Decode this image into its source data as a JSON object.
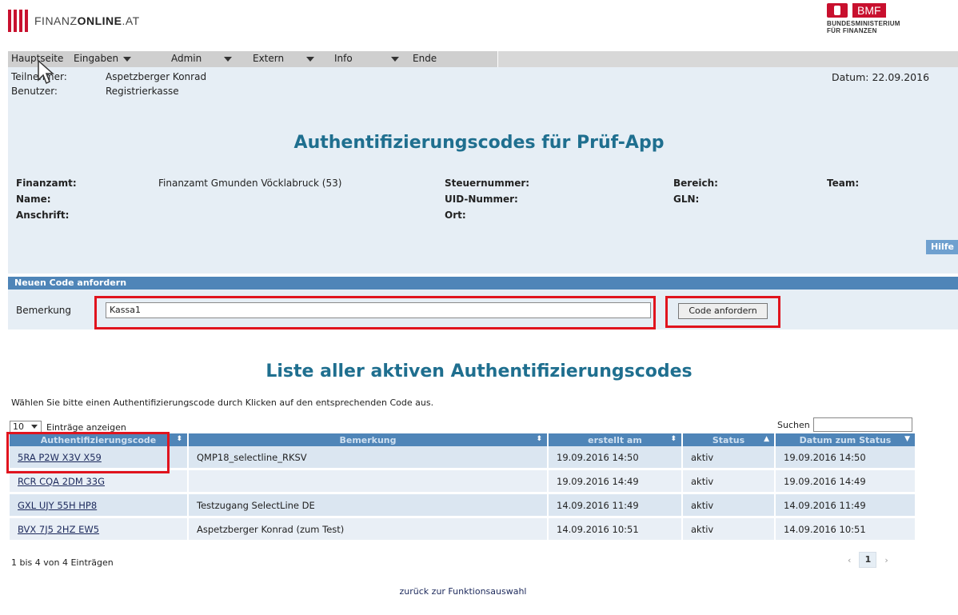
{
  "header": {
    "logo_text_light": "FINANZ",
    "logo_text_bold": "ONLINE",
    "logo_text_suffix": ".AT",
    "bmf_label": "BMF",
    "bmf_sub1": "BUNDESMINISTERIUM",
    "bmf_sub2": "FÜR FINANZEN"
  },
  "menu": {
    "items": [
      {
        "label": "Hauptseite"
      },
      {
        "label": "Eingaben"
      },
      {
        "label": "Admin"
      },
      {
        "label": "Extern"
      },
      {
        "label": "Info"
      },
      {
        "label": "Ende"
      }
    ]
  },
  "session": {
    "participant_label": "Teilnehmer:",
    "participant_value": "Aspetzberger Konrad",
    "user_label": "Benutzer:",
    "user_value": "Registrierkasse",
    "date_label": "Datum: 22.09.2016"
  },
  "page_title": "Authentifizierungscodes für Prüf-App",
  "taxinfo": {
    "finanzamt_label": "Finanzamt:",
    "finanzamt_value": "Finanzamt Gmunden Vöcklabruck (53)",
    "name_label": "Name:",
    "anschrift_label": "Anschrift:",
    "steuernummer_label": "Steuernummer:",
    "uid_label": "UID-Nummer:",
    "ort_label": "Ort:",
    "bereich_label": "Bereich:",
    "gln_label": "GLN:",
    "team_label": "Team:"
  },
  "help_label": "Hilfe",
  "new_code": {
    "header": "Neuen Code anfordern",
    "remark_label": "Bemerkung",
    "remark_value": "Kassa1",
    "button_label": "Code anfordern"
  },
  "list_title": "Liste aller aktiven Authentifizierungscodes",
  "instruction": "Wählen Sie bitte einen Authentifizierungscode durch Klicken auf den entsprechenden Code aus.",
  "table_controls": {
    "length_value": "10",
    "length_label": "Einträge anzeigen",
    "search_label": "Suchen"
  },
  "table": {
    "columns": [
      "Authentifizierungscode",
      "Bemerkung",
      "erstellt am",
      "Status",
      "Datum zum Status"
    ],
    "rows": [
      {
        "code": "5RA P2W X3V X59",
        "remark": "QMP18_selectline_RKSV",
        "created": "19.09.2016 14:50",
        "status": "aktiv",
        "status_date": "19.09.2016 14:50"
      },
      {
        "code": "RCR CQA 2DM 33G",
        "remark": "",
        "created": "19.09.2016 14:49",
        "status": "aktiv",
        "status_date": "19.09.2016 14:49"
      },
      {
        "code": "GXL UJY 55H HP8",
        "remark": "Testzugang SelectLine DE",
        "created": "14.09.2016 11:49",
        "status": "aktiv",
        "status_date": "14.09.2016 11:49"
      },
      {
        "code": "BVX 7J5 2HZ EW5",
        "remark": "Aspetzberger Konrad (zum Test)",
        "created": "14.09.2016 10:51",
        "status": "aktiv",
        "status_date": "14.09.2016 10:51"
      }
    ]
  },
  "footer": {
    "info": "1 bis 4 von 4 Einträgen",
    "page_prev": "‹",
    "page_current": "1",
    "page_next": "›",
    "back_link": "zurück zur Funktionsauswahl"
  },
  "colors": {
    "brand_red": "#c8102e",
    "title_blue": "#1f6f8f",
    "header_blue": "#4f85b8",
    "panel_bg": "#e6eef5",
    "highlight_red": "#e0141e"
  }
}
